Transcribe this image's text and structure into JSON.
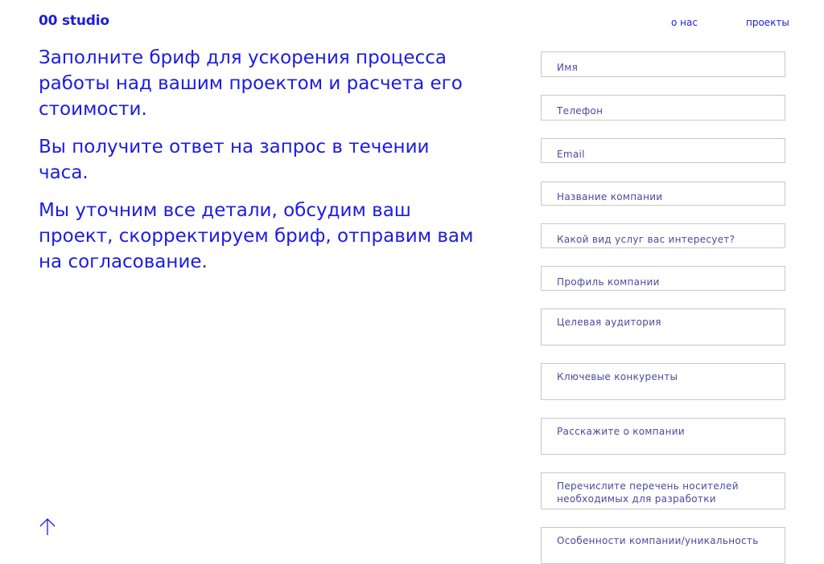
{
  "header": {
    "logo": "00 studio",
    "nav": {
      "about": "о нас",
      "projects": "проекты"
    }
  },
  "intro": {
    "p1": "Заполните бриф для ускорения процесса работы над вашим проектом и расчета его стоимости.",
    "p2": "Вы получите ответ на запрос в течении часа.",
    "p3": "Мы уточним все детали, обсудим ваш проект, скорректируем бриф, отправим вам на согласование."
  },
  "form": {
    "name": "Имя",
    "phone": "Телефон",
    "email": "Email",
    "company": "Название компании",
    "services": "Какой вид услуг вас интересует?",
    "profile": "Профиль компании",
    "audience": "Целевая аудитория",
    "competitors": "Ключевые конкуренты",
    "about_company": "Расскажите о компании",
    "media": "Перечислите перечень носителей необходимых для разработки",
    "features": "Особенности компании/уникальность"
  },
  "icons": {
    "scroll_top": "arrow-up-icon"
  },
  "colors": {
    "accent": "#1c1ce0",
    "border": "#c8c8c8",
    "background": "#ffffff"
  }
}
